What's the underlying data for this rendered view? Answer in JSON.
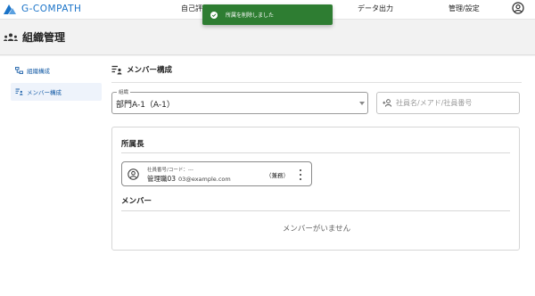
{
  "app": {
    "logo_text": "G-COMPATH"
  },
  "nav": {
    "items": [
      {
        "label": "自己評"
      },
      {
        "label": "データ出力"
      },
      {
        "label": "管理/設定"
      }
    ]
  },
  "toast": {
    "message": "所属を削除しました"
  },
  "page": {
    "title": "組織管理"
  },
  "sidebar": {
    "items": [
      {
        "label": "組織構成"
      },
      {
        "label": "メンバー構成"
      }
    ]
  },
  "section": {
    "title": "メンバー構成"
  },
  "org_select": {
    "label": "組織",
    "value": "部門A-1（A-1）"
  },
  "search": {
    "placeholder": "社員名/メアド/社員番号"
  },
  "manager_section": {
    "title": "所属長",
    "card": {
      "code": "社員番号/コード：---",
      "name": "管理職03",
      "email": "03@example.com",
      "concurrent": "（兼務）"
    }
  },
  "members_section": {
    "title": "メンバー",
    "empty_message": "メンバーがいません"
  },
  "colors": {
    "brand": "#1a73c8",
    "toast_bg": "#2e7d32",
    "active_bg": "#eef3fb"
  }
}
